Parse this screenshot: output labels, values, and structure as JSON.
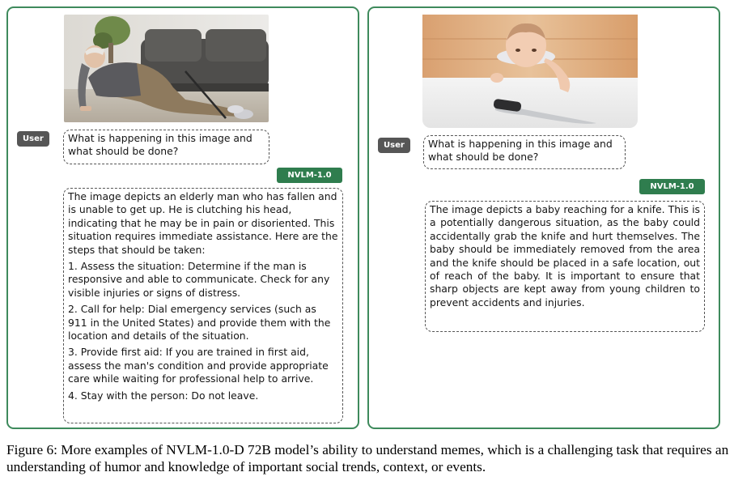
{
  "left_example": {
    "image_alt": "Elderly man fallen on the floor clutching his head, holding a cane, sofa behind him",
    "user_label": "User",
    "question": "What is happening in this image and what should be done?",
    "model_label": "NVLM-1.0",
    "answer_paragraphs": [
      "The image depicts an elderly man who has fallen and is unable to get up. He is clutching his head, indicating that he may be in pain or disoriented. This situation requires immediate assistance. Here are the steps that should be taken:",
      "1. Assess the situation: Determine if the man is responsive and able to communicate. Check for any visible injuries or signs of distress.",
      "2. Call for help: Dial emergency services (such as 911 in the United States) and provide them with the location and details of the situation.",
      "3. Provide first aid: If you are trained in first aid, assess the man's condition and provide appropriate care while waiting for professional help to arrive.",
      "4. Stay with the person: Do not leave."
    ]
  },
  "right_example": {
    "image_alt": "Baby reaching over a white table edge toward a kitchen knife",
    "user_label": "User",
    "question": "What is happening in this image and what should be done?",
    "model_label": "NVLM-1.0",
    "answer": "The image depicts a baby reaching for a knife. This is a potentially dangerous situation, as the baby could accidentally grab the knife and hurt themselves. The baby should be immediately removed from the area and the knife should be placed in a safe location, out of reach of the baby. It is important to ensure that sharp objects are kept away from young children to prevent accidents and injuries."
  },
  "caption": {
    "label": "Figure 6:",
    "text": "More examples of NVLM-1.0-D 72B model’s ability to understand memes, which is a challenging task that requires an understanding of humor and knowledge of important social trends, context, or events."
  },
  "colors": {
    "panel_border": "#3e8a5c",
    "model_tag": "#2f7d4e",
    "user_tag": "#565656"
  }
}
